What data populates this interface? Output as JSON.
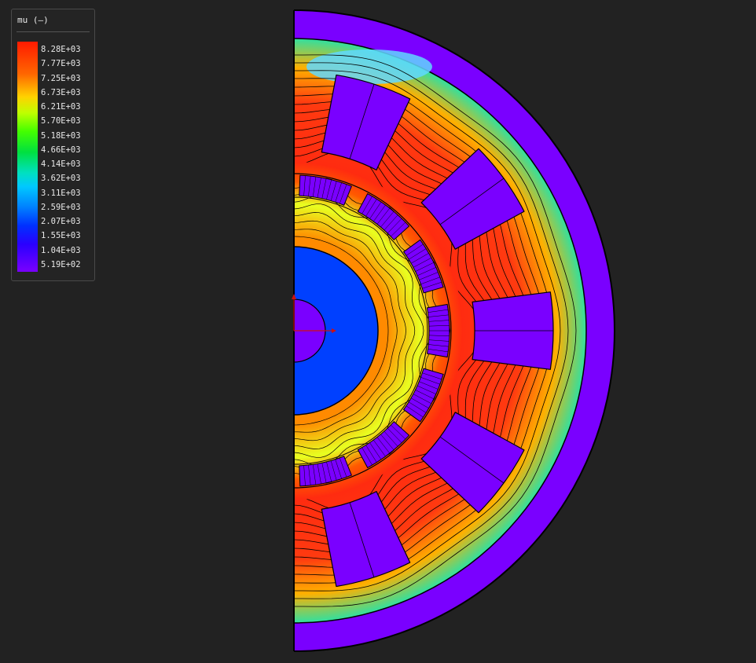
{
  "legend": {
    "title": "mu (–)",
    "labels": [
      "8.28E+03",
      "7.77E+03",
      "7.25E+03",
      "6.73E+03",
      "6.21E+03",
      "5.70E+03",
      "5.18E+03",
      "4.66E+03",
      "4.14E+03",
      "3.62E+03",
      "3.11E+03",
      "2.59E+03",
      "2.07E+03",
      "1.55E+03",
      "1.04E+03",
      "5.19E+02"
    ]
  },
  "colors": {
    "background": "#222222",
    "outer_shell": "#7a00ff",
    "stator_fill": "#ff3a10",
    "shaft": "#0040ff",
    "slot": "#7a00ff",
    "axis": "#cc1111"
  },
  "plot": {
    "stator_slot_count": 10,
    "rotor_tooth_count": 7,
    "view": "half-section"
  }
}
